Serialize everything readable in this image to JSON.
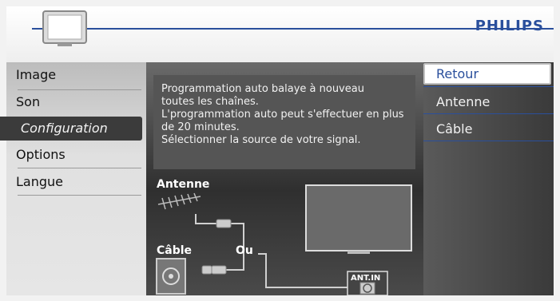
{
  "brand": {
    "logo_text": "PHILIPS",
    "accent_color": "#2a4f9c"
  },
  "left_menu": {
    "items": [
      {
        "label": "Image",
        "active": false
      },
      {
        "label": "Son",
        "active": false
      },
      {
        "label": "Configuration",
        "active": true
      },
      {
        "label": "Options",
        "active": false
      },
      {
        "label": "Langue",
        "active": false
      }
    ]
  },
  "info": {
    "line1": "Programmation auto balaye à nouveau",
    "line2": "toutes les chaînes.",
    "line3": "L'programmation auto peut s'effectuer en plus",
    "line4": "de 20 minutes.",
    "line5": "Sélectionner la source de votre signal."
  },
  "diagram": {
    "antenna_label": "Antenne",
    "cable_label": "Câble",
    "or_label": "Ou",
    "ant_in_label": "ANT.IN"
  },
  "right_menu": {
    "items": [
      {
        "label": "Retour",
        "selected": true
      },
      {
        "label": "Antenne",
        "selected": false
      },
      {
        "label": "Câble",
        "selected": false
      }
    ]
  }
}
